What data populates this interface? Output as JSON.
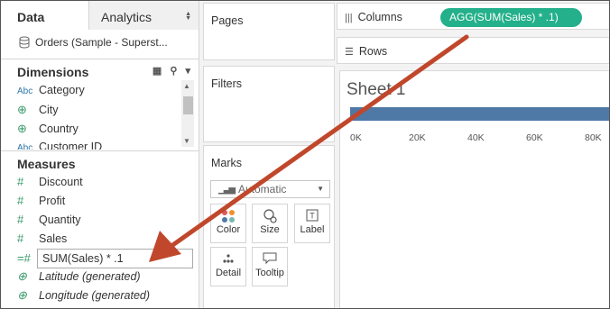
{
  "data_pane": {
    "tab_data": "Data",
    "tab_analytics": "Analytics",
    "datasource": "Orders (Sample - Superst...",
    "dimensions_title": "Dimensions",
    "dimensions": [
      {
        "type": "Abc",
        "label": "Category"
      },
      {
        "type": "globe",
        "label": "City"
      },
      {
        "type": "globe",
        "label": "Country"
      },
      {
        "type": "Abc",
        "label": "Customer ID"
      }
    ],
    "measures_title": "Measures",
    "measures": [
      {
        "type": "#",
        "label": "Discount"
      },
      {
        "type": "#",
        "label": "Profit"
      },
      {
        "type": "#",
        "label": "Quantity"
      },
      {
        "type": "#",
        "label": "Sales"
      }
    ],
    "calc_field_value": "SUM(Sales) * .1",
    "generated": [
      {
        "type": "globe",
        "label": "Latitude (generated)"
      },
      {
        "type": "globe",
        "label": "Longitude (generated)"
      }
    ]
  },
  "cards": {
    "pages": "Pages",
    "filters": "Filters",
    "marks": "Marks",
    "mark_type": "Automatic",
    "buttons": [
      "Color",
      "Size",
      "Label",
      "Detail",
      "Tooltip"
    ]
  },
  "shelves": {
    "columns": "Columns",
    "rows": "Rows",
    "columns_pill": "AGG(SUM(Sales) * .1)"
  },
  "sheet": {
    "title": "Sheet 1",
    "ticks": [
      "0K",
      "20K",
      "40K",
      "60K",
      "80K"
    ]
  },
  "chart_data": {
    "type": "bar",
    "categories": [
      ""
    ],
    "values": [
      88000
    ],
    "xlim": [
      0,
      88000
    ]
  },
  "colors": {
    "pill": "#23b08a",
    "bar": "#4e79a7",
    "arrow": "#c0472b"
  }
}
